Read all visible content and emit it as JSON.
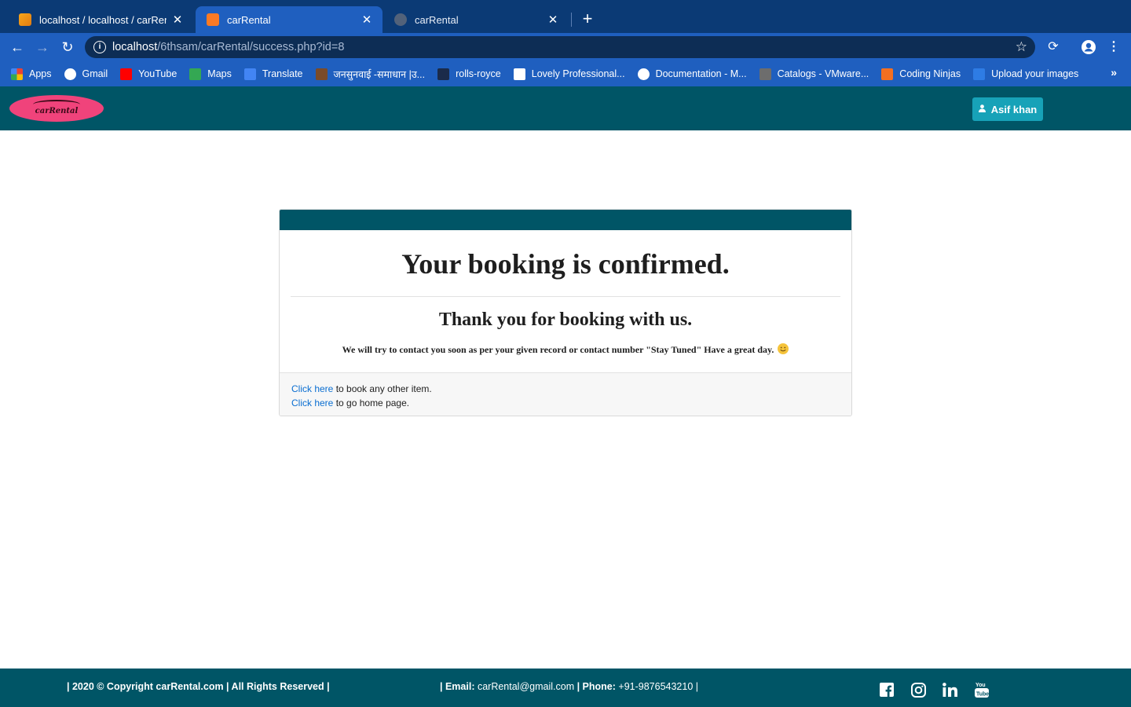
{
  "browser": {
    "tabs": [
      {
        "title": "localhost / localhost / carRental /",
        "favicon": "phpmyadmin-icon"
      },
      {
        "title": "carRental",
        "favicon": "xampp-icon"
      },
      {
        "title": "carRental",
        "favicon": "globe-icon"
      }
    ],
    "url_host": "localhost",
    "url_path": "/6thsam/carRental/success.php?id=8",
    "bookmarks": [
      {
        "label": "Apps",
        "icon": "apps-grid-icon",
        "color": "#e94235"
      },
      {
        "label": "Gmail",
        "icon": "google-icon",
        "color": "#ffffff"
      },
      {
        "label": "YouTube",
        "icon": "youtube-icon",
        "color": "#ff0000"
      },
      {
        "label": "Maps",
        "icon": "maps-icon",
        "color": "#34a853"
      },
      {
        "label": "Translate",
        "icon": "translate-icon",
        "color": "#4285f4"
      },
      {
        "label": "जनसुनवाई -समाधान |उ...",
        "icon": "emblem-icon",
        "color": "#7a4b2a"
      },
      {
        "label": "rolls-royce",
        "icon": "rolls-royce-icon",
        "color": "#1b2b4a"
      },
      {
        "label": "Lovely Professional...",
        "icon": "external-link-icon",
        "color": "#ffffff"
      },
      {
        "label": "Documentation - M...",
        "icon": "globe-icon",
        "color": "#ffffff"
      },
      {
        "label": "Catalogs - VMware...",
        "icon": "vmware-icon",
        "color": "#6d6d6d"
      },
      {
        "label": "Coding Ninjas",
        "icon": "coding-ninjas-icon",
        "color": "#f36f21"
      },
      {
        "label": "Upload your images",
        "icon": "ibb-icon",
        "color": "#2e7ce4"
      }
    ]
  },
  "header": {
    "logo_text": "carRental",
    "user_label": "Asif khan"
  },
  "card": {
    "title": "Your booking is confirmed.",
    "subtitle": "Thank you for booking with us.",
    "message": "We will try to contact you soon as per your given record or contact number \"Stay Tuned\" Have a great day.",
    "link1_text": "Click here",
    "link1_rest": " to book any other item.",
    "link2_text": "Click here",
    "link2_rest": " to go home page."
  },
  "footer": {
    "copyright": "| 2020 © Copyright carRental.com | All Rights Reserved |",
    "email_label": "| Email:",
    "email_value": " carRental@gmail.com ",
    "phone_label": "| Phone:",
    "phone_value": " +91-9876543210 ",
    "end_bar": "|",
    "social": [
      "facebook-icon",
      "instagram-icon",
      "linkedin-icon",
      "youtube-icon"
    ]
  },
  "colors": {
    "brand_teal": "#005566",
    "user_button": "#17a2b8",
    "logo_pink": "#f0437b",
    "link": "#0a6ed1"
  }
}
